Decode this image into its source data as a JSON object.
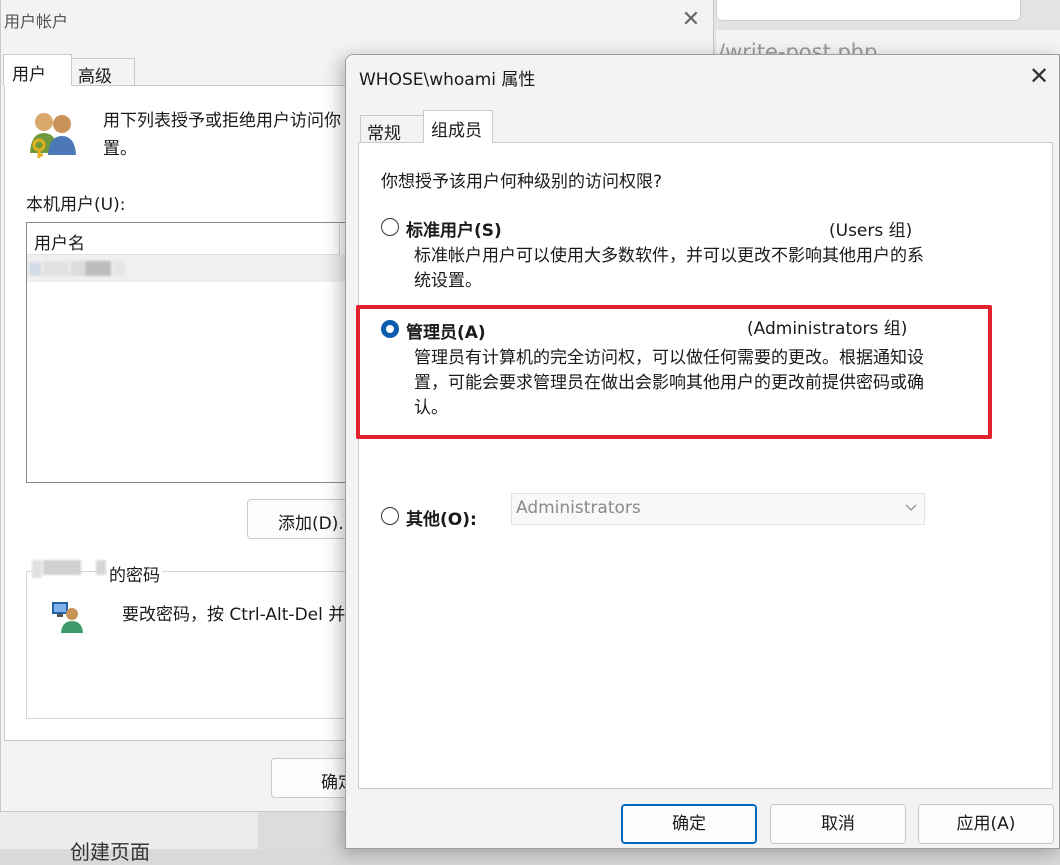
{
  "background": {
    "url_fragment": "/write-post.php",
    "bottom_text": "创建页面"
  },
  "accounts_window": {
    "title": "用户帐户",
    "tabs": [
      {
        "label": "用户"
      },
      {
        "label": "高级"
      }
    ],
    "description_line1": "用下列表授予或拒绝用户访问你",
    "description_line2": "置。",
    "local_users_label": "本机用户(U):",
    "column_header": "用户名",
    "add_button": "添加(D)...",
    "password_group_label": "的密码",
    "password_text": "要改密码，按 Ctrl-Alt-Del 并",
    "ok_button": "确定"
  },
  "properties_dialog": {
    "title": "WHOSE\\whoami 属性",
    "tabs": [
      {
        "label": "常规"
      },
      {
        "label": "组成员"
      }
    ],
    "question": "你想授予该用户何种级别的访问权限?",
    "options": [
      {
        "label": "标准用户(S)",
        "group": "(Users 组)",
        "desc": "标准帐户用户可以使用大多数软件，并可以更改不影响其他用户的系统设置。",
        "checked": false
      },
      {
        "label": "管理员(A)",
        "group": "(Administrators 组)",
        "desc": "管理员有计算机的完全访问权，可以做任何需要的更改。根据通知设置，可能会要求管理员在做出会影响其他用户的更改前提供密码或确认。",
        "checked": true
      },
      {
        "label": "其他(O):",
        "checked": false
      }
    ],
    "other_select_value": "Administrators",
    "buttons": {
      "ok": "确定",
      "cancel": "取消",
      "apply": "应用(A)"
    },
    "highlight_color": "#e5202e",
    "accent_color": "#0b5cad"
  }
}
